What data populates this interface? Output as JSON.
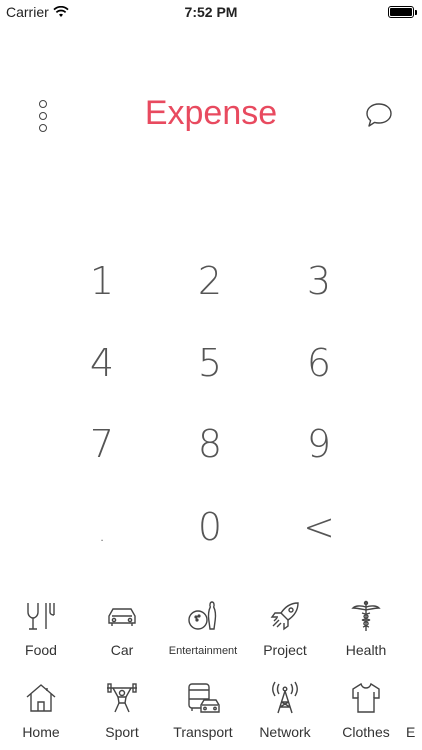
{
  "status_bar": {
    "carrier": "Carrier",
    "time": "7:52 PM"
  },
  "header": {
    "title": "Expense"
  },
  "keypad": {
    "keys": [
      "1",
      "2",
      "3",
      "4",
      "5",
      "6",
      "7",
      "8",
      "9",
      ".",
      "0",
      "<"
    ]
  },
  "categories": {
    "row1": [
      "Food",
      "Car",
      "Entertainment",
      "Project",
      "Health"
    ],
    "row2": [
      "Home",
      "Sport",
      "Transport",
      "Network",
      "Clothes"
    ],
    "partial": "E"
  },
  "colors": {
    "accent": "#e84a5f"
  }
}
